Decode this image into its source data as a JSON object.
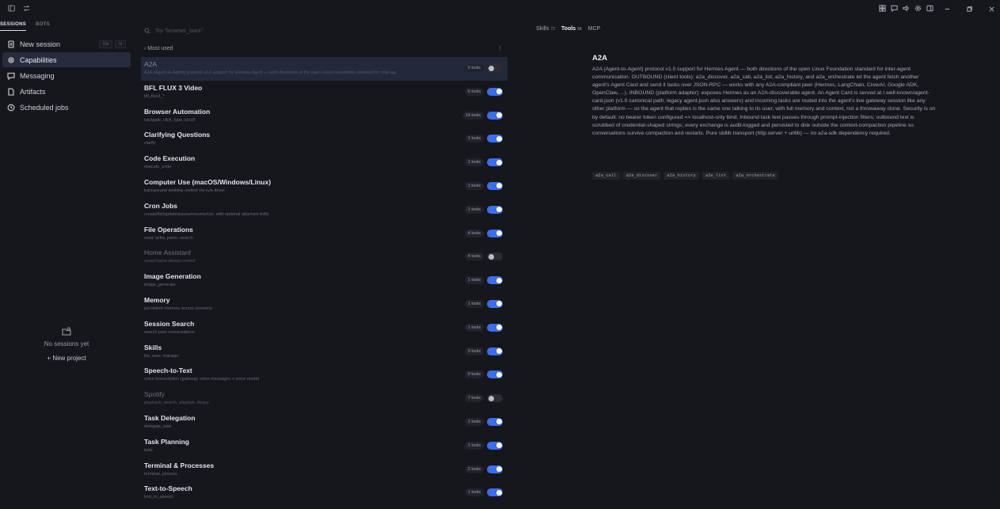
{
  "sidebar": {
    "tabs": [
      "SESSIONS",
      "BOTS"
    ],
    "new_session": "New session",
    "kbd": [
      "Ctrl",
      "N"
    ],
    "items": [
      {
        "label": "Capabilities"
      },
      {
        "label": "Messaging"
      },
      {
        "label": "Artifacts"
      },
      {
        "label": "Scheduled jobs"
      }
    ],
    "empty_text": "No sessions yet",
    "new_project": "+ New project"
  },
  "search": {
    "placeholder": "Try \"browser_back\""
  },
  "group": {
    "label": "Most used"
  },
  "capabilities": [
    {
      "title": "A2A",
      "desc": "A2A (Agent-to-Agent) protocol v1.0 support for Hermes Agent — both directions of the open Linux Foundation standard for inter-ag...",
      "tools": "5 tools",
      "on": false,
      "selected": true
    },
    {
      "title": "BFL FLUX 3 Video",
      "desc": "bfl_flux3_*",
      "tools": "6 tools",
      "on": true
    },
    {
      "title": "Browser Automation",
      "desc": "navigate, click, type, scroll",
      "tools": "14 tools",
      "on": true
    },
    {
      "title": "Clarifying Questions",
      "desc": "clarify",
      "tools": "1 tools",
      "on": true
    },
    {
      "title": "Code Execution",
      "desc": "execute_code",
      "tools": "1 tools",
      "on": true
    },
    {
      "title": "Computer Use (macOS/Windows/Linux)",
      "desc": "background desktop control via cua-driver",
      "tools": "1 tools",
      "on": true
    },
    {
      "title": "Cron Jobs",
      "desc": "create/list/update/pause/resume/run, with optional attached skills",
      "tools": "1 tools",
      "on": true
    },
    {
      "title": "File Operations",
      "desc": "read, write, patch, search",
      "tools": "4 tools",
      "on": true
    },
    {
      "title": "Home Assistant",
      "desc": "smart home device control",
      "tools": "4 tools",
      "on": false
    },
    {
      "title": "Image Generation",
      "desc": "image_generate",
      "tools": "1 tools",
      "on": true
    },
    {
      "title": "Memory",
      "desc": "persistent memory across sessions",
      "tools": "1 tools",
      "on": true
    },
    {
      "title": "Session Search",
      "desc": "search past conversations",
      "tools": "1 tools",
      "on": true
    },
    {
      "title": "Skills",
      "desc": "list, view, manage",
      "tools": "3 tools",
      "on": true
    },
    {
      "title": "Speech-to-Text",
      "desc": "voice transcription (gateway voice messages + voice mode)",
      "tools": "0 tools",
      "on": true
    },
    {
      "title": "Spotify",
      "desc": "playback, search, playlists, library",
      "tools": "7 tools",
      "on": false
    },
    {
      "title": "Task Delegation",
      "desc": "delegate_task",
      "tools": "1 tools",
      "on": true
    },
    {
      "title": "Task Planning",
      "desc": "todo",
      "tools": "1 tools",
      "on": true
    },
    {
      "title": "Terminal & Processes",
      "desc": "terminal, process",
      "tools": "2 tools",
      "on": true
    },
    {
      "title": "Text-to-Speech",
      "desc": "text_to_speech",
      "tools": "1 tools",
      "on": true
    }
  ],
  "detail": {
    "tabs": [
      {
        "label": "Skills",
        "count": "72"
      },
      {
        "label": "Tools",
        "count": "24"
      },
      {
        "label": "MCP",
        "count": ""
      }
    ],
    "title": "A2A",
    "description": "A2A (Agent-to-Agent) protocol v1.0 support for Hermes Agent — both directions of the open Linux Foundation standard for inter-agent communication. OUTBOUND (client tools): a2a_discover, a2a_call, a2a_list, a2a_history, and a2a_orchestrate let the agent fetch another agent's Agent Card and send it tasks over JSON-RPC — works with any A2A-compliant peer (Hermes, LangChain, CrewAI, Google ADK, OpenClaw, ...). INBOUND (platform adapter): exposes Hermes as an A2A-discoverable agent. An Agent Card is served at /.well-known/agent-card.json (v1.0 canonical path; legacy agent.json also answers) and incoming tasks are routed into the agent's live gateway session like any other platform — so the agent that replies is the same one talking to its user, with full memory and context, not a throwaway clone. Security is on by default: no bearer token configured => localhost-only bind. Inbound task text passes through prompt-injection filters; outbound text is scrubbed of credential-shaped strings; every exchange is audit-logged and persisted to disk outside the context-compaction pipeline so conversations survive compaction and restarts. Pure stdlib transport (http.server + urllib) — no a2a-sdk dependency required.",
    "tools": [
      "a2a_call",
      "a2a_discover",
      "a2a_history",
      "a2a_list",
      "a2a_orchestrate"
    ]
  },
  "colors": {
    "accent": "#3d6ee8",
    "bg": "#16161d",
    "selected_row": "#23283a"
  }
}
